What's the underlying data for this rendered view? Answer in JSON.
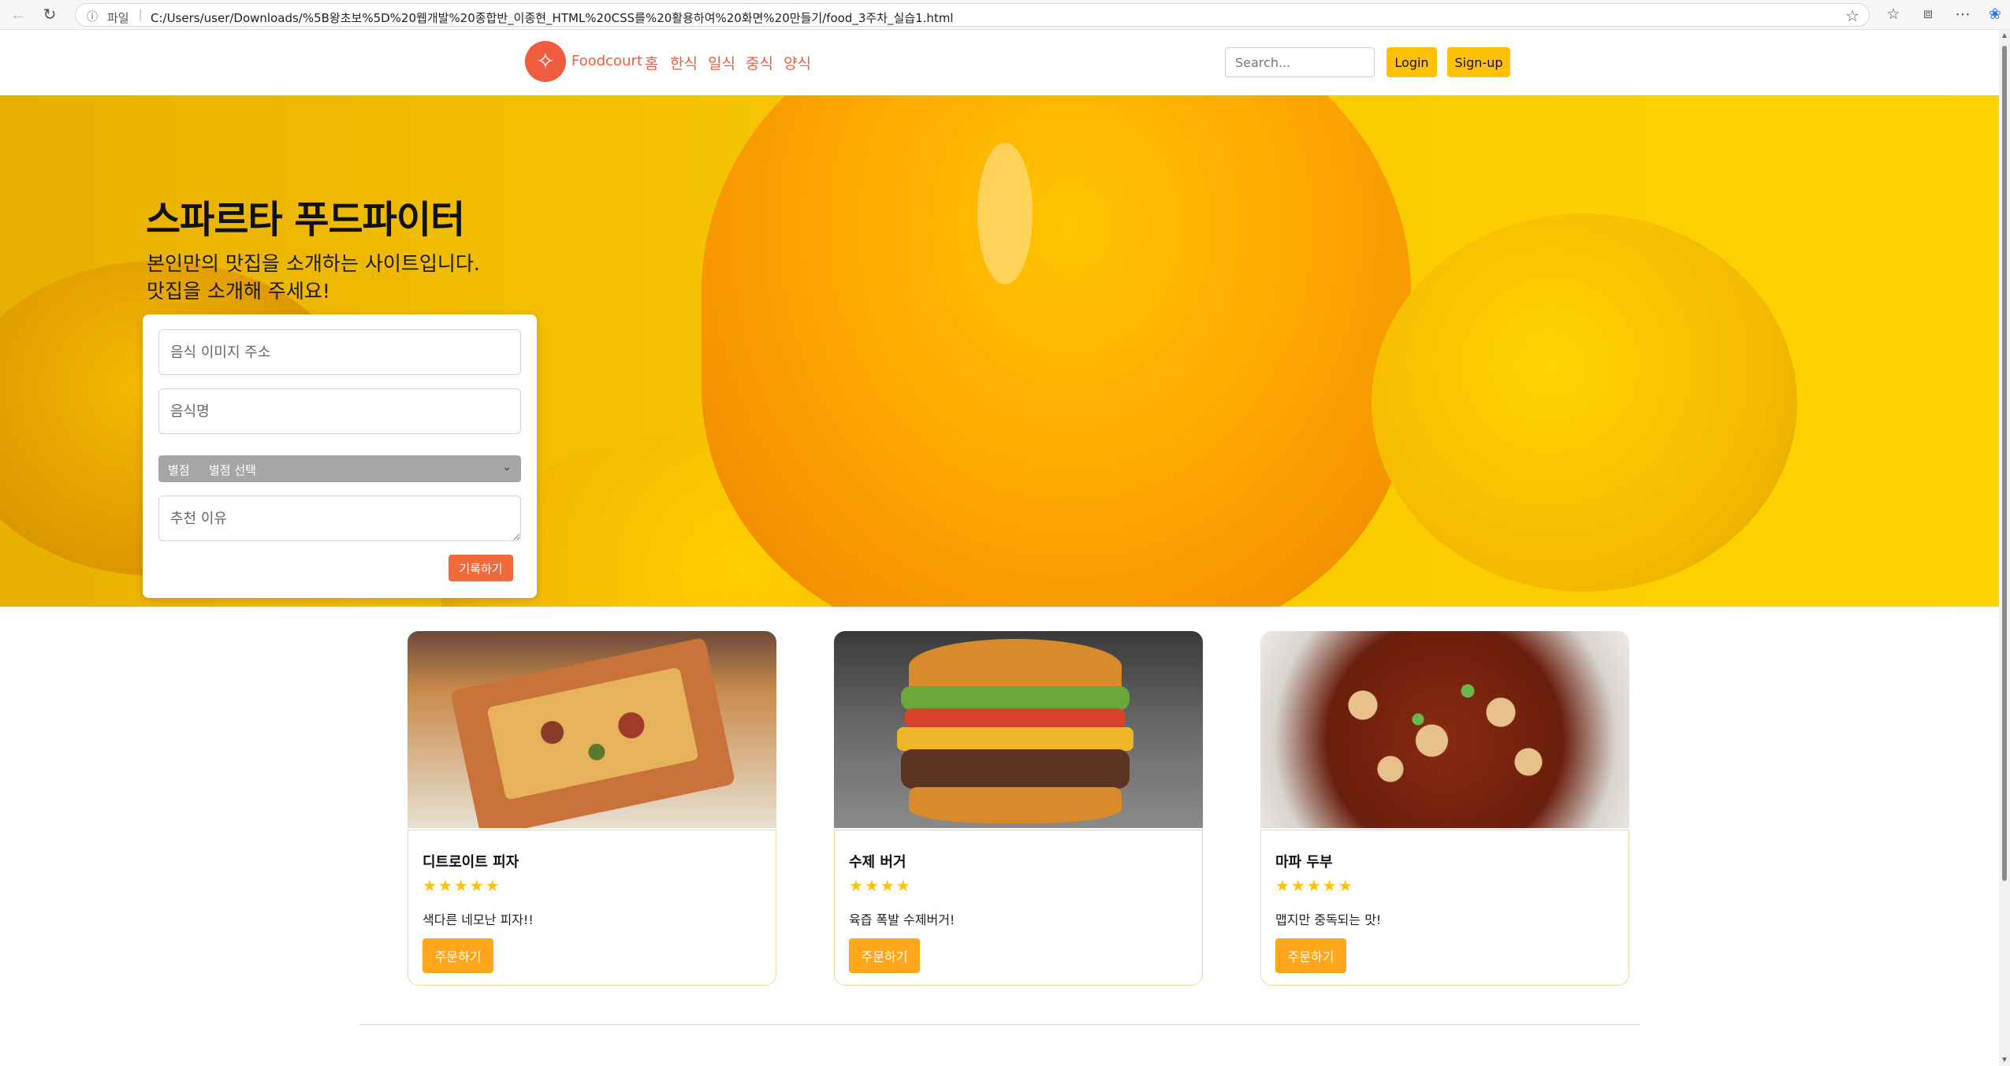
{
  "browser": {
    "info_label": "파일",
    "url": "C:/Users/user/Downloads/%5B왕초보%5D%20웹개발%20종합반_이종현_HTML%20CSS를%20활용하여%20화면%20만들기/food_3주차_실습1.html"
  },
  "header": {
    "brand": "Foodcourt",
    "nav": [
      "홈",
      "한식",
      "일식",
      "중식",
      "양식"
    ],
    "search_placeholder": "Search...",
    "login_label": "Login",
    "signup_label": "Sign-up"
  },
  "hero": {
    "title": "스파르타 푸드파이터",
    "line1": "본인만의 맛집을 소개하는 사이트입니다.",
    "line2": "맛집을 소개해 주세요!"
  },
  "form": {
    "image_placeholder": "음식 이미지 주소",
    "name_placeholder": "음식명",
    "rating_label": "별점",
    "rating_selected": "별점 선택",
    "reason_placeholder": "추천 이유",
    "submit_label": "기록하기"
  },
  "cards": [
    {
      "title": "디트로이트 피자",
      "stars": "★★★★★",
      "desc": "색다른 네모난 피자!!",
      "button": "주문하기"
    },
    {
      "title": "수제 버거",
      "stars": "★★★★",
      "desc": "육즙 폭발 수제버거!",
      "button": "주문하기"
    },
    {
      "title": "마파 두부",
      "stars": "★★★★★",
      "desc": "맵지만 중독되는 맛!",
      "button": "주문하기"
    }
  ],
  "colors": {
    "brand": "#f05d3e",
    "button_yellow": "#ffc107",
    "order_button": "#ffa61a",
    "submit_button": "#f26a3a",
    "card_border": "#fbd29b"
  }
}
